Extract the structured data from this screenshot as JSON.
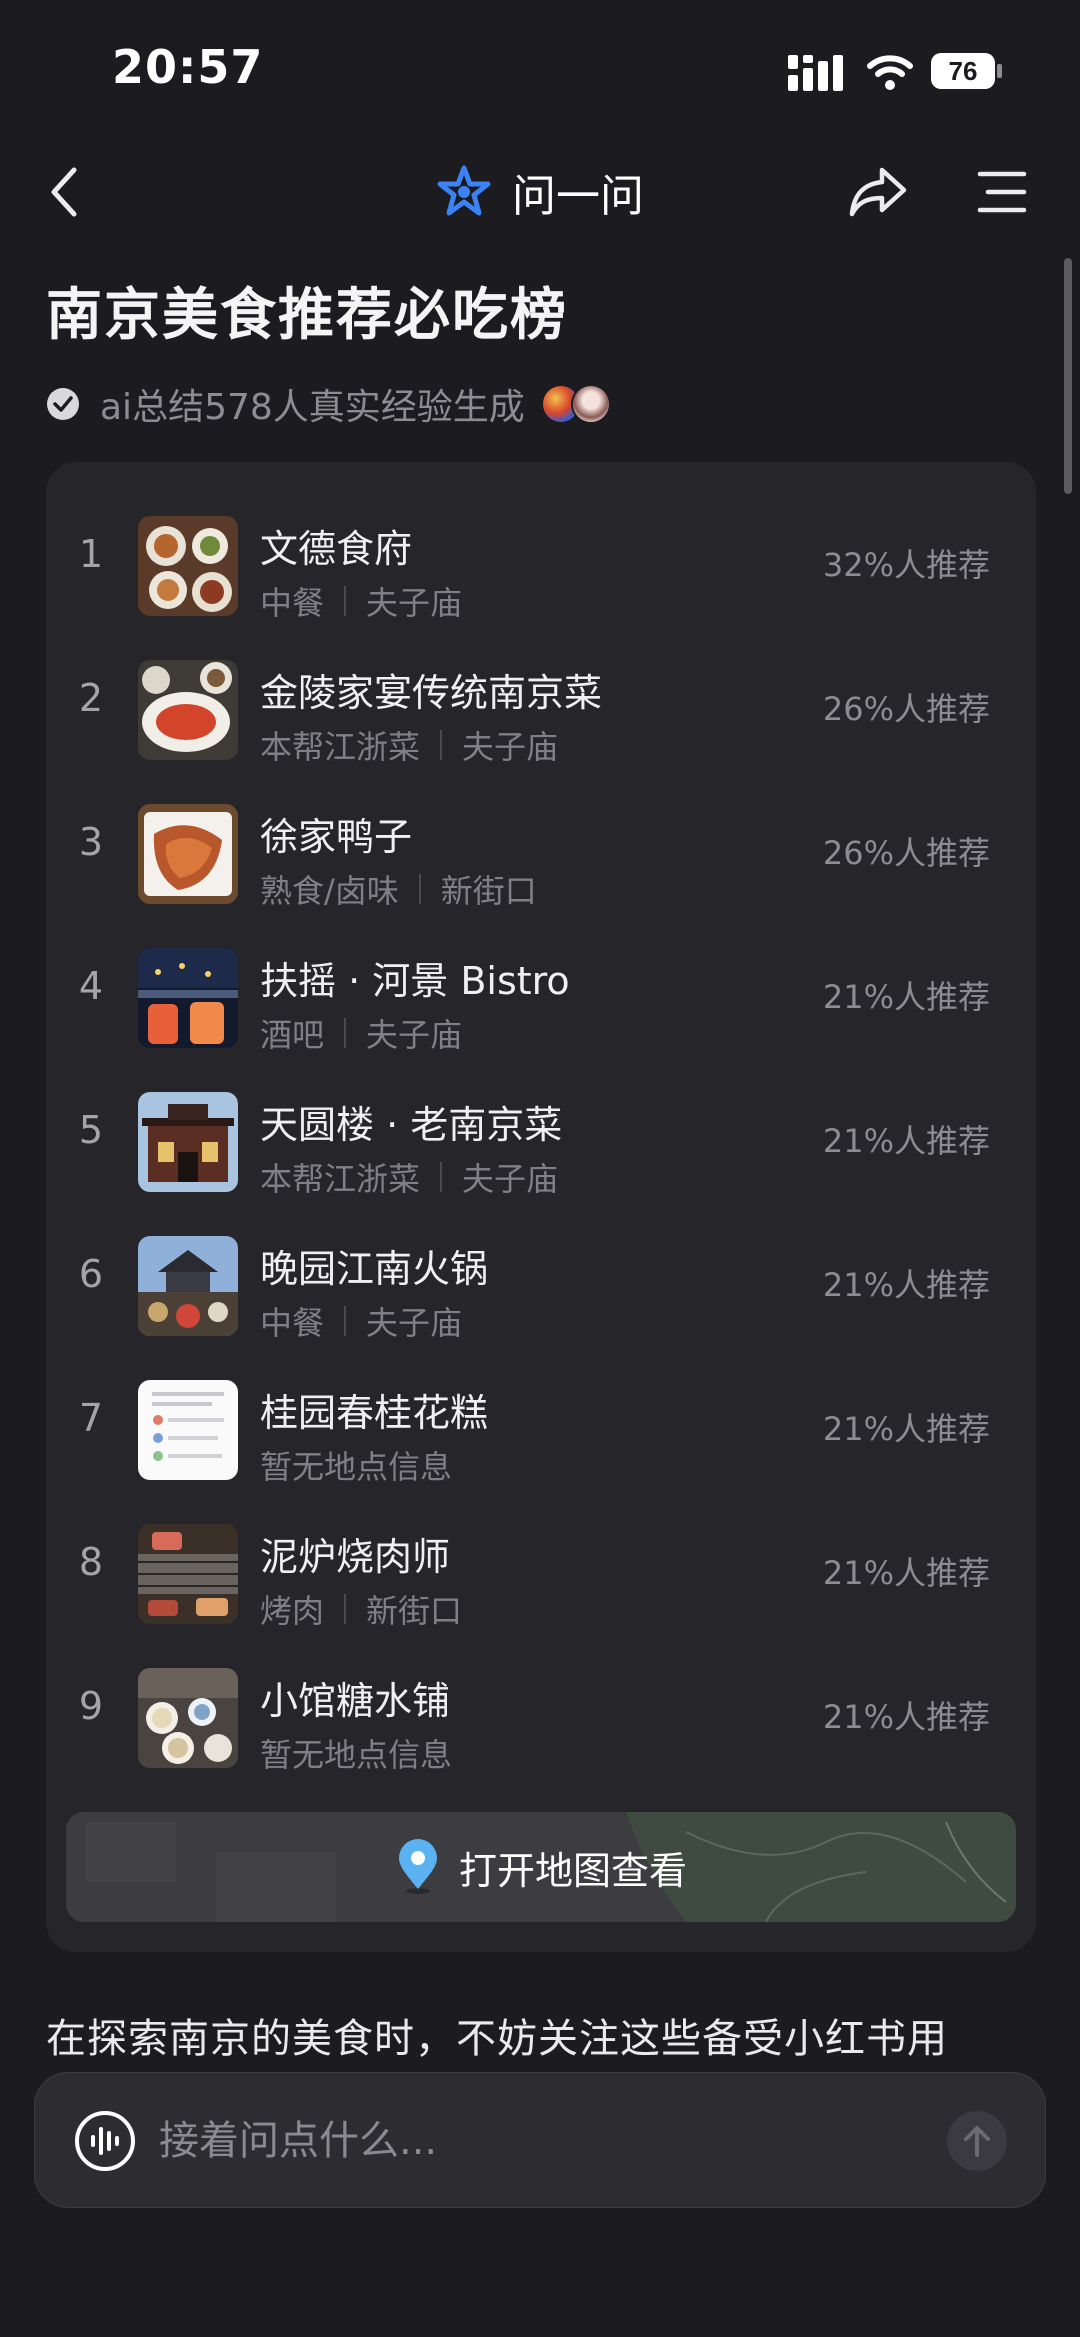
{
  "status_bar": {
    "time": "20:57",
    "battery": "76"
  },
  "nav": {
    "title": "问一问"
  },
  "page_title": "南京美食推荐必吃榜",
  "summary": "ai总结578人真实经验生成",
  "rankings": [
    {
      "rank": "1",
      "name": "文德食府",
      "category": "中餐",
      "area": "夫子庙",
      "percent": "32%人推荐"
    },
    {
      "rank": "2",
      "name": "金陵家宴传统南京菜",
      "category": "本帮江浙菜",
      "area": "夫子庙",
      "percent": "26%人推荐"
    },
    {
      "rank": "3",
      "name": "徐家鸭子",
      "category": "熟食/卤味",
      "area": "新街口",
      "percent": "26%人推荐"
    },
    {
      "rank": "4",
      "name": "扶摇 · 河景 Bistro",
      "category": "酒吧",
      "area": "夫子庙",
      "percent": "21%人推荐"
    },
    {
      "rank": "5",
      "name": "天圆楼 · 老南京菜",
      "category": "本帮江浙菜",
      "area": "夫子庙",
      "percent": "21%人推荐"
    },
    {
      "rank": "6",
      "name": "晚园江南火锅",
      "category": "中餐",
      "area": "夫子庙",
      "percent": "21%人推荐"
    },
    {
      "rank": "7",
      "name": "桂园春桂花糕",
      "category": "暂无地点信息",
      "area": "",
      "percent": "21%人推荐"
    },
    {
      "rank": "8",
      "name": "泥炉烧肉师",
      "category": "烤肉",
      "area": "新街口",
      "percent": "21%人推荐"
    },
    {
      "rank": "9",
      "name": "小馆糖水铺",
      "category": "暂无地点信息",
      "area": "",
      "percent": "21%人推荐"
    }
  ],
  "map_button": {
    "label": "打开地图查看"
  },
  "answer_text": "在探索南京的美食时，不妨关注这些备受小红书用",
  "input": {
    "placeholder": "接着问点什么..."
  },
  "colors": {
    "background": "#1c1c20",
    "card": "#25252a",
    "accent": "#3b82f6",
    "text_muted": "#8c8c92"
  }
}
